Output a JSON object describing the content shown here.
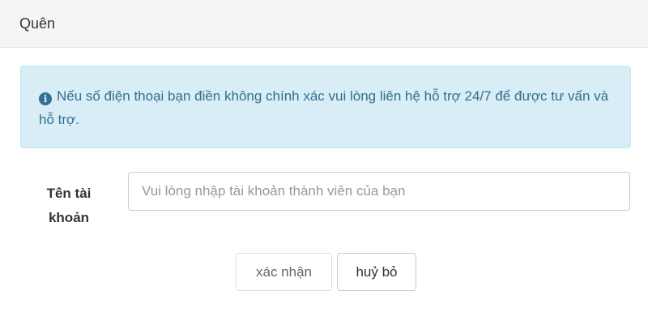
{
  "modal": {
    "title": "Quên"
  },
  "alert": {
    "icon": "info-icon",
    "icon_glyph": "i",
    "message": "Nếu số điện thoại bạn điền không chính xác vui lòng liên hệ hỗ trợ 24/7 để được tư vấn và hỗ trợ."
  },
  "form": {
    "username_label_line1": "Tên tài",
    "username_label_line2": "khoản",
    "username_value": "",
    "username_placeholder": "Vui lòng nhập tài khoản thành viên của bạn"
  },
  "buttons": {
    "confirm_label": "xác nhận",
    "cancel_label": "huỷ bỏ"
  },
  "colors": {
    "alert_bg": "#d9edf7",
    "alert_text": "#31708f",
    "header_bg": "#f5f5f5"
  }
}
